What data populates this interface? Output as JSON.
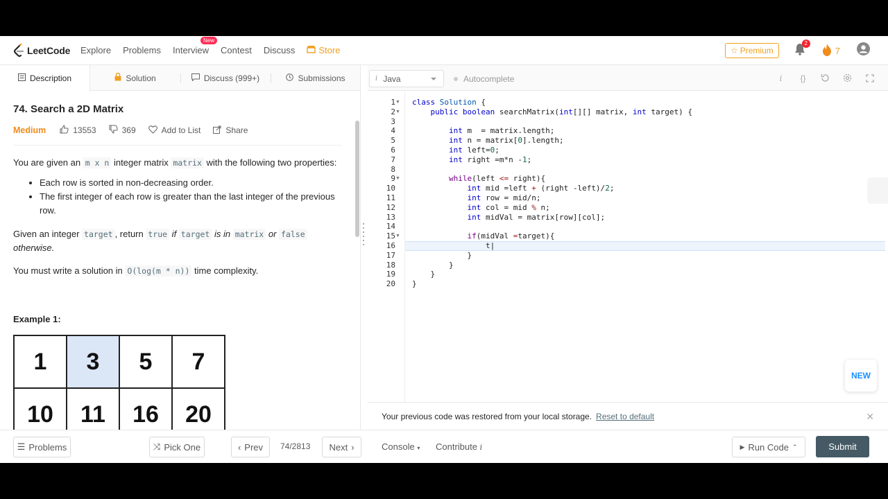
{
  "nav": {
    "logo_text": "LeetCode",
    "links": [
      "Explore",
      "Problems",
      "Interview",
      "Contest",
      "Discuss"
    ],
    "new_badge": "New",
    "store_label": "Store",
    "premium_label": "Premium",
    "notification_count": "2",
    "streak_count": "7"
  },
  "left_tabs": {
    "description": "Description",
    "solution": "Solution",
    "discuss": "Discuss (999+)",
    "submissions": "Submissions"
  },
  "problem": {
    "title": "74. Search a 2D Matrix",
    "difficulty": "Medium",
    "likes": "13553",
    "dislikes": "369",
    "add_to_list": "Add to List",
    "share": "Share",
    "desc_1a": "You are given an ",
    "desc_1_code1": "m x n",
    "desc_1b": " integer matrix ",
    "desc_1_code2": "matrix",
    "desc_1c": " with the following two properties:",
    "properties": [
      "Each row is sorted in non-decreasing order.",
      "The first integer of each row is greater than the last integer of the previous row."
    ],
    "desc_2a": "Given an integer ",
    "desc_2_code1": "target",
    "desc_2b": ", return ",
    "desc_2_code2": "true",
    "desc_2c": " if ",
    "desc_2_code3": "target",
    "desc_2d": " is in ",
    "desc_2_code4": "matrix",
    "desc_2e": " or ",
    "desc_2_code5": "false",
    "desc_2f": " otherwise.",
    "desc_3a": "You must write a solution in ",
    "desc_3_code": "O(log(m * n))",
    "desc_3b": " time complexity.",
    "example_title": "Example 1:",
    "matrix": [
      "1",
      "3",
      "5",
      "7",
      "10",
      "11",
      "16",
      "20"
    ],
    "highlight_color": "#dbe6f7"
  },
  "editor": {
    "language": "Java",
    "autocomplete": "Autocomplete",
    "line_numbers": [
      "1",
      "2",
      "3",
      "4",
      "5",
      "6",
      "7",
      "8",
      "9",
      "10",
      "11",
      "12",
      "13",
      "14",
      "15",
      "16",
      "17",
      "18",
      "19",
      "20"
    ],
    "restored_msg": "Your previous code was restored from your local storage.",
    "reset_label": "Reset to default",
    "new_label": "NEW"
  },
  "bottom": {
    "problems": "Problems",
    "pick_one": "Pick One",
    "prev": "Prev",
    "page": "74/2813",
    "next": "Next",
    "console": "Console",
    "contribute": "Contribute",
    "run_code": "Run Code",
    "submit": "Submit"
  },
  "colors": {
    "accent_orange": "#f0a020",
    "medium": "#ef8c1c",
    "submit_bg": "#455a64"
  }
}
